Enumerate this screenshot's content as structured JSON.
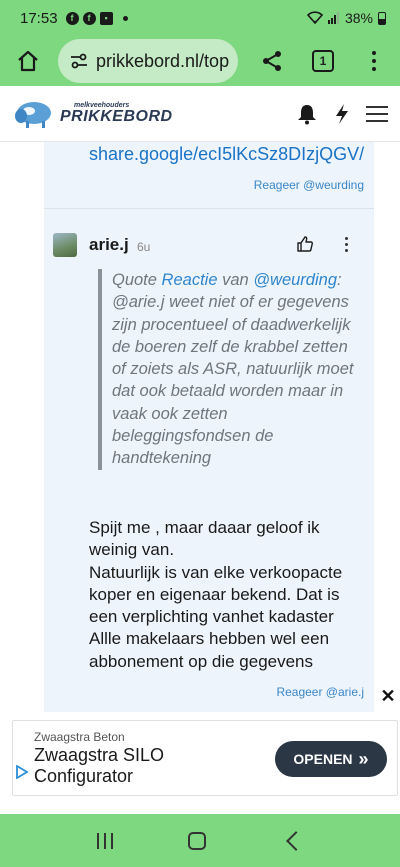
{
  "status_bar": {
    "time": "17:53",
    "battery": "38%"
  },
  "browser": {
    "url": "prikkebord.nl/top",
    "tab_count": "1"
  },
  "site": {
    "logo_small": "melkveehouders",
    "logo_big": "PRIKKEBORD"
  },
  "thread": {
    "prev_link": "share.google/ecI5lKcSz8DIzjQGV/",
    "prev_reply": "Reageer @weurding"
  },
  "comment": {
    "author": "arie.j",
    "time_ago": "6u",
    "quote": {
      "prefix": "Quote ",
      "link1": "Reactie",
      "middle": " van ",
      "link2": "@weurding",
      "text": ": @arie.j weet niet of er gegevens zijn procentueel of daadwerkelijk de boeren zelf de krabbel zetten of zoiets als ASR, natuurlijk moet dat ook betaald worden maar in vaak ook zetten beleggingsfondsen de handtekening"
    },
    "body_lines": [
      "Spijt me , maar daaar geloof ik weinig van.",
      "Natuurlijk is van elke verkoopacte koper en eigenaar bekend. Dat is een verplichting vanhet kadaster",
      "Allle makelaars hebben wel een abbonement op die gegevens"
    ],
    "reply_label": "Reageer @arie.j"
  },
  "ad": {
    "sponsor": "Zwaagstra Beton",
    "title": "Zwaagstra SILO Configurator",
    "cta": "OPENEN",
    "cta_arrow": "»",
    "close": "✕"
  }
}
